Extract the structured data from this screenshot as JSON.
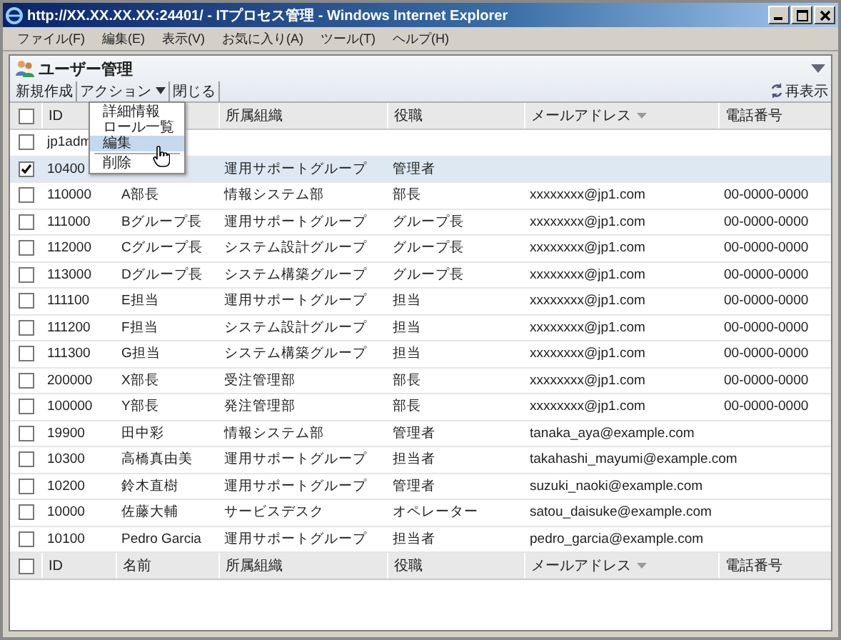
{
  "window": {
    "title": "http://XX.XX.XX.XX:24401/ - ITプロセス管理 - Windows Internet Explorer"
  },
  "menu_bar": [
    "ファイル(F)",
    "編集(E)",
    "表示(V)",
    "お気に入り(A)",
    "ツール(T)",
    "ヘルプ(H)"
  ],
  "app": {
    "title": "ユーザー管理",
    "toolbar": [
      {
        "label": "新規作成",
        "kind": "button"
      },
      {
        "label": "アクション",
        "kind": "dropdown"
      },
      {
        "label": "閉じる",
        "kind": "button"
      }
    ],
    "refresh": "再表示"
  },
  "action_menu": [
    {
      "label": "詳細情報",
      "selected": false
    },
    {
      "label": "ロール一覧",
      "selected": false
    },
    {
      "label": "編集",
      "selected": true
    },
    {
      "label": "削除",
      "selected": false
    }
  ],
  "table": {
    "header_checked": false,
    "columns": [
      {
        "label": "ID",
        "sorted": false
      },
      null,
      {
        "label": "所属組織",
        "sorted": false
      },
      {
        "label": "役職",
        "sorted": false
      },
      {
        "label": "メールアドレス",
        "sorted": true
      },
      {
        "label": "電話番号",
        "sorted": false
      }
    ],
    "rows": [
      {
        "checked": false,
        "selected": false,
        "cells": [
          "jp1adm",
          null,
          null,
          null,
          null,
          null
        ]
      },
      {
        "checked": true,
        "selected": true,
        "cells": [
          "10400",
          null,
          "運用サポートグループ",
          "管理者",
          null,
          null
        ]
      },
      {
        "checked": false,
        "selected": false,
        "cells": [
          "110000",
          "A部長",
          "情報システム部",
          "部長",
          "xxxxxxxx@jp1.com",
          "00-0000-0000"
        ]
      },
      {
        "checked": false,
        "selected": false,
        "cells": [
          "111000",
          "Bグループ長",
          "運用サポートグループ",
          "グループ長",
          "xxxxxxxx@jp1.com",
          "00-0000-0000"
        ]
      },
      {
        "checked": false,
        "selected": false,
        "cells": [
          "112000",
          "Cグループ長",
          "システム設計グループ",
          "グループ長",
          "xxxxxxxx@jp1.com",
          "00-0000-0000"
        ]
      },
      {
        "checked": false,
        "selected": false,
        "cells": [
          "113000",
          "Dグループ長",
          "システム構築グループ",
          "グループ長",
          "xxxxxxxx@jp1.com",
          "00-0000-0000"
        ]
      },
      {
        "checked": false,
        "selected": false,
        "cells": [
          "111100",
          "E担当",
          "運用サポートグループ",
          "担当",
          "xxxxxxxx@jp1.com",
          "00-0000-0000"
        ]
      },
      {
        "checked": false,
        "selected": false,
        "cells": [
          "111200",
          "F担当",
          "システム設計グループ",
          "担当",
          "xxxxxxxx@jp1.com",
          "00-0000-0000"
        ]
      },
      {
        "checked": false,
        "selected": false,
        "cells": [
          "111300",
          "G担当",
          "システム構築グループ",
          "担当",
          "xxxxxxxx@jp1.com",
          "00-0000-0000"
        ]
      },
      {
        "checked": false,
        "selected": false,
        "cells": [
          "200000",
          "X部長",
          "受注管理部",
          "部長",
          "xxxxxxxx@jp1.com",
          "00-0000-0000"
        ]
      },
      {
        "checked": false,
        "selected": false,
        "cells": [
          "100000",
          "Y部長",
          "発注管理部",
          "部長",
          "xxxxxxxx@jp1.com",
          "00-0000-0000"
        ]
      },
      {
        "checked": false,
        "selected": false,
        "cells": [
          "19900",
          "田中彩",
          "情報システム部",
          "管理者",
          "tanaka_aya@example.com",
          null
        ]
      },
      {
        "checked": false,
        "selected": false,
        "cells": [
          "10300",
          "高橋真由美",
          "運用サポートグループ",
          "担当者",
          "takahashi_mayumi@example.com",
          null
        ]
      },
      {
        "checked": false,
        "selected": false,
        "cells": [
          "10200",
          "鈴木直樹",
          "運用サポートグループ",
          "管理者",
          "suzuki_naoki@example.com",
          null
        ]
      },
      {
        "checked": false,
        "selected": false,
        "cells": [
          "10000",
          "佐藤大輔",
          "サービスデスク",
          "オペレーター",
          "satou_daisuke@example.com",
          null
        ]
      },
      {
        "checked": false,
        "selected": false,
        "cells": [
          "10100",
          "Pedro Garcia",
          "運用サポートグループ",
          "担当者",
          "pedro_garcia@example.com",
          null
        ]
      }
    ],
    "footer_checked": false,
    "footer_columns": [
      {
        "label": "ID",
        "sorted": false
      },
      {
        "label": "名前",
        "sorted": false
      },
      {
        "label": "所属組織",
        "sorted": false
      },
      {
        "label": "役職",
        "sorted": false
      },
      {
        "label": "メールアドレス",
        "sorted": true
      },
      {
        "label": "電話番号",
        "sorted": false
      }
    ]
  }
}
